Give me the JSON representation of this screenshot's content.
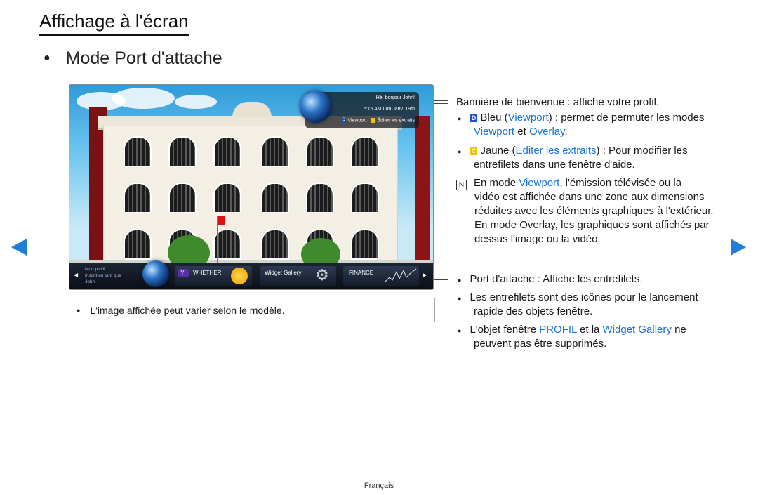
{
  "page": {
    "title": "Affichage à l'écran",
    "subtitle": "Mode Port d'attache",
    "footer": "Français"
  },
  "screen": {
    "welcome": {
      "greeting": "Hé, bonjour John!",
      "datetime": "5:15 AM Lun Janv. 19th",
      "key_d": "D",
      "viewport": "Viewport",
      "editer": "Éditer les extraits"
    },
    "dock": {
      "profile_title": "Mon profil",
      "profile_sub": "Inscrit en tant que",
      "profile_name": "John",
      "whether_label": "WHETHER",
      "gallery_label": "Widget Gallery",
      "finance_label": "FINANCE"
    },
    "note": "L'image affichée peut varier selon le modèle."
  },
  "desc": {
    "banner": "Bannière de bienvenue : affiche votre profil.",
    "b1_key": "D",
    "b1_a": "Bleu (",
    "b1_link1": "Viewport",
    "b1_b": ") : permet de permuter les modes",
    "b1_link2": "Viewport",
    "b1_c": " et ",
    "b1_link3": "Overlay",
    "b1_d": ".",
    "b2_key": "C",
    "b2_a": "Jaune (",
    "b2_link": "Éditer les extraits",
    "b2_b": ") : Pour modifier les",
    "b2_c": "entrefilets dans une fenêtre d'aide.",
    "note_mark": "N",
    "n_a": "En mode ",
    "n_link": "Viewport",
    "n_b": ", l'émission télévisée ou la",
    "n_l2": "vidéo est affichée dans une zone aux dimensions",
    "n_l3": "réduites avec les éléments graphiques à l'extérieur.",
    "n_l4": "En mode Overlay, les graphiques sont affichés par",
    "n_l5": "dessus l'image ou la vidéo.",
    "p1": "Port d'attache : Affiche les entrefilets.",
    "p2_a": "Les entrefilets sont des icônes pour le lancement",
    "p2_b": "rapide des objets fenêtre.",
    "p3_a": "L'objet fenêtre ",
    "p3_link1": "PROFIL",
    "p3_b": " et la ",
    "p3_link2": "Widget Gallery",
    "p3_c": " ne",
    "p3_d": "peuvent pas être supprimés."
  },
  "colors": {
    "link": "#1a73d6",
    "nav_arrow": "#1f7fd8",
    "key_blue": "#1a4fd0",
    "key_yellow": "#f2c200"
  },
  "icons": [
    "prev-arrow-icon",
    "next-arrow-icon",
    "globe-icon",
    "gear-icon",
    "weather-icon",
    "yahoo-icon",
    "note-icon"
  ]
}
